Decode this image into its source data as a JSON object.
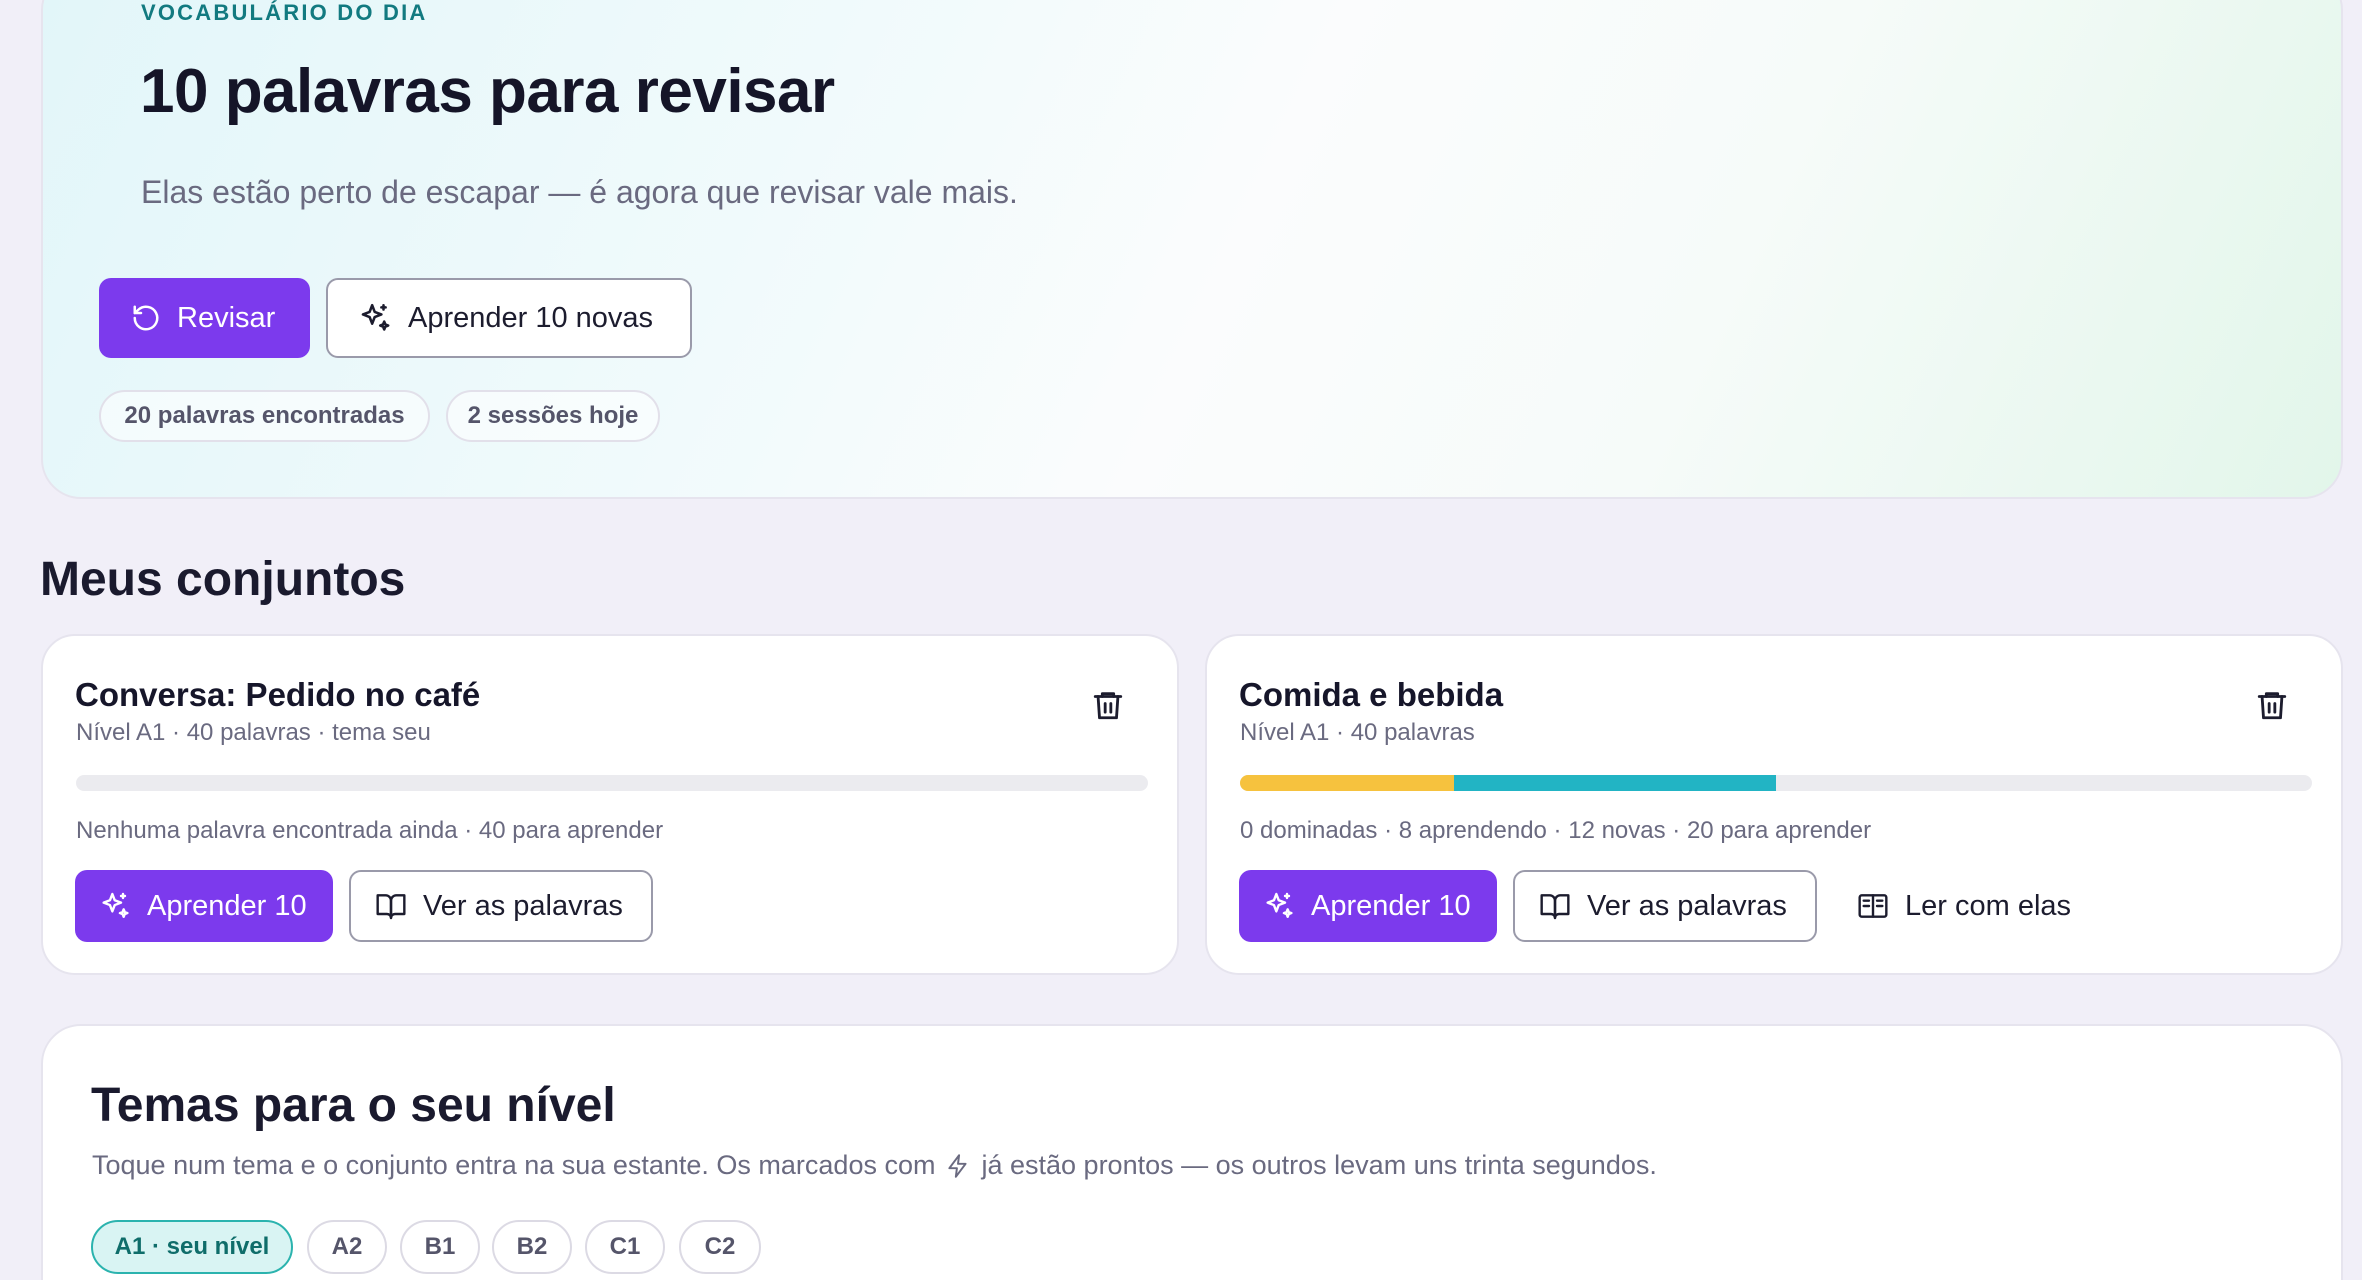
{
  "hero": {
    "eyebrow": "VOCABULÁRIO DO DIA",
    "title": "10 palavras para revisar",
    "subtitle": "Elas estão perto de escapar — é agora que revisar vale mais.",
    "review_button": "Revisar",
    "learn_button": "Aprender 10 novas",
    "chips": [
      "20 palavras encontradas",
      "2 sessões hoje"
    ]
  },
  "sets_title": "Meus conjuntos",
  "sets": [
    {
      "title": "Conversa: Pedido no café",
      "meta": "Nível A1 · 40 palavras · tema seu",
      "status": "Nenhuma palavra encontrada ainda · 40 para aprender",
      "progress": {
        "mastered": 0,
        "learning": 0,
        "new": 0,
        "total": 40
      },
      "learn_button": "Aprender 10",
      "view_button": "Ver as palavras"
    },
    {
      "title": "Comida e bebida",
      "meta": "Nível A1 · 40 palavras",
      "status": "0 dominadas · 8 aprendendo · 12 novas · 20 para aprender",
      "progress": {
        "mastered": 0,
        "learning": 8,
        "new": 12,
        "total": 40
      },
      "learn_button": "Aprender 10",
      "view_button": "Ver as palavras",
      "read_button": "Ler com elas"
    }
  ],
  "themes": {
    "title": "Temas para o seu nível",
    "desc_before": "Toque num tema e o conjunto entra na sua estante. Os marcados com",
    "desc_after": "já estão prontos — os outros levam uns trinta segundos.",
    "levels": [
      "A1 · seu nível",
      "A2",
      "B1",
      "B2",
      "C1",
      "C2"
    ]
  },
  "colors": {
    "accent": "#7c3aed",
    "teal": "#127a80",
    "progress_learning": "#f6c23e",
    "progress_new": "#22b4c4"
  },
  "icons": {
    "review": "rotate-ccw-icon",
    "sparkle": "sparkles-icon",
    "book": "book-open-icon",
    "reader": "book-text-icon",
    "trash": "trash-icon",
    "lightning": "lightning-icon"
  }
}
